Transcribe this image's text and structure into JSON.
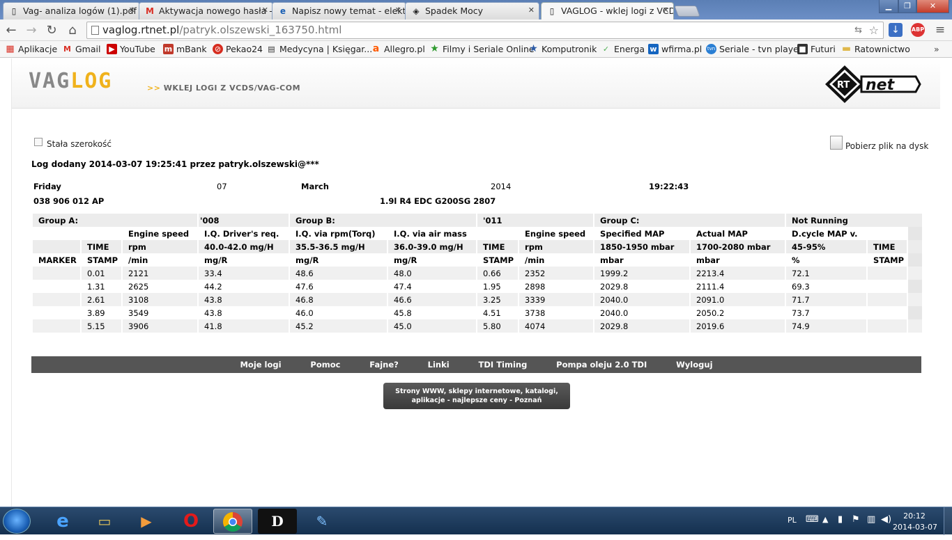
{
  "browser": {
    "tabs": [
      {
        "title": "Vag- analiza logów (1).pdf",
        "icon": "document-icon"
      },
      {
        "title": "Aktywacja nowego hasła -",
        "icon": "gmail-icon"
      },
      {
        "title": "Napisz nowy temat - elekt",
        "icon": "ie-icon"
      },
      {
        "title": "Spadek Mocy",
        "icon": "forum-icon"
      },
      {
        "title": "VAGLOG - wklej logi z VCD",
        "icon": "document-icon"
      }
    ],
    "url_host": "vaglog.rtnet.pl",
    "url_path": "/patryk.olszewski_163750.html",
    "bookmarks": [
      {
        "label": "Aplikacje",
        "color": "#d93025"
      },
      {
        "label": "Gmail",
        "color": "#d93025"
      },
      {
        "label": "YouTube",
        "color": "#cc0000"
      },
      {
        "label": "mBank",
        "color": "#c0392b"
      },
      {
        "label": "Pekao24",
        "color": "#d62d20"
      },
      {
        "label": "Medycyna | Księgar...",
        "color": "#333333"
      },
      {
        "label": "Allegro.pl",
        "color": "#ff5a00"
      },
      {
        "label": "Filmy i Seriale Online",
        "color": "#2e9a2e"
      },
      {
        "label": "Komputronik",
        "color": "#2b5aa5"
      },
      {
        "label": "Energa",
        "color": "#4caf50"
      },
      {
        "label": "wfirma.pl",
        "color": "#1565c0"
      },
      {
        "label": "Seriale - tvn player",
        "color": "#2a7fd4"
      },
      {
        "label": "Futuri",
        "color": "#333333"
      },
      {
        "label": "Ratownictwo",
        "color": "#e0b84c"
      }
    ]
  },
  "page": {
    "logo_vag": "VAG",
    "logo_log": "LOG",
    "logo_tag_arrows": ">>",
    "logo_tag": "WKLEJ LOGI Z VCDS/VAG-COM",
    "rtnet_logo": "RT net",
    "fixed_width_label": "Stała szerokość",
    "download_label": "Pobierz plik na dysk",
    "added_line": "Log dodany 2014-03-07 19:25:41 przez patryk.olszewski@***",
    "header": {
      "day": "Friday",
      "date": "07",
      "month": "March",
      "year": "2014",
      "time": "19:22:43",
      "part_no": "038 906 012 AP",
      "engine": "1.9l R4 EDC G200SG 2807"
    },
    "groups": {
      "a_label": "Group A:",
      "a_value": "'008",
      "b_label": "Group B:",
      "b_value": "'011",
      "c_label": "Group C:",
      "c_value": "Not Running"
    },
    "col_heads": {
      "r1": [
        "",
        "",
        "Engine speed",
        "I.Q. Driver's req.",
        "I.Q. via rpm(Torq)",
        "I.Q. via air mass",
        "",
        "Engine speed",
        "Specified MAP",
        "Actual MAP",
        "D.cycle MAP v.",
        ""
      ],
      "r2": [
        "",
        "TIME",
        "rpm",
        "40.0-42.0 mg/H",
        "35.5-36.5 mg/H",
        "36.0-39.0 mg/H",
        "TIME",
        "rpm",
        "1850-1950 mbar",
        "1700-2080 mbar",
        "45-95%",
        "TIME"
      ],
      "r3": [
        "MARKER",
        "STAMP",
        "/min",
        "mg/R",
        "mg/R",
        "mg/R",
        "STAMP",
        "/min",
        "mbar",
        "mbar",
        "%",
        "STAMP"
      ]
    },
    "rows": [
      [
        "",
        "0.01",
        "2121",
        "33.4",
        "48.6",
        "48.0",
        "0.66",
        "2352",
        "1999.2",
        "2213.4",
        "72.1",
        ""
      ],
      [
        "",
        "1.31",
        "2625",
        "44.2",
        "47.6",
        "47.4",
        "1.95",
        "2898",
        "2029.8",
        "2111.4",
        "69.3",
        ""
      ],
      [
        "",
        "2.61",
        "3108",
        "43.8",
        "46.8",
        "46.6",
        "3.25",
        "3339",
        "2040.0",
        "2091.0",
        "71.7",
        ""
      ],
      [
        "",
        "3.89",
        "3549",
        "43.8",
        "46.0",
        "45.8",
        "4.51",
        "3738",
        "2040.0",
        "2050.2",
        "73.7",
        ""
      ],
      [
        "",
        "5.15",
        "3906",
        "41.8",
        "45.2",
        "45.0",
        "5.80",
        "4074",
        "2029.8",
        "2019.6",
        "74.9",
        ""
      ]
    ],
    "footer_links": [
      "Moje logi",
      "Pomoc",
      "Fajne?",
      "Linki",
      "TDI Timing",
      "Pompa oleju 2.0 TDI",
      "Wyloguj"
    ],
    "ad_text": "Strony WWW, sklepy internetowe, katalogi, aplikacje - najlepsze ceny - Poznań"
  },
  "taskbar": {
    "lang": "PL",
    "time": "20:12",
    "date": "2014-03-07"
  }
}
